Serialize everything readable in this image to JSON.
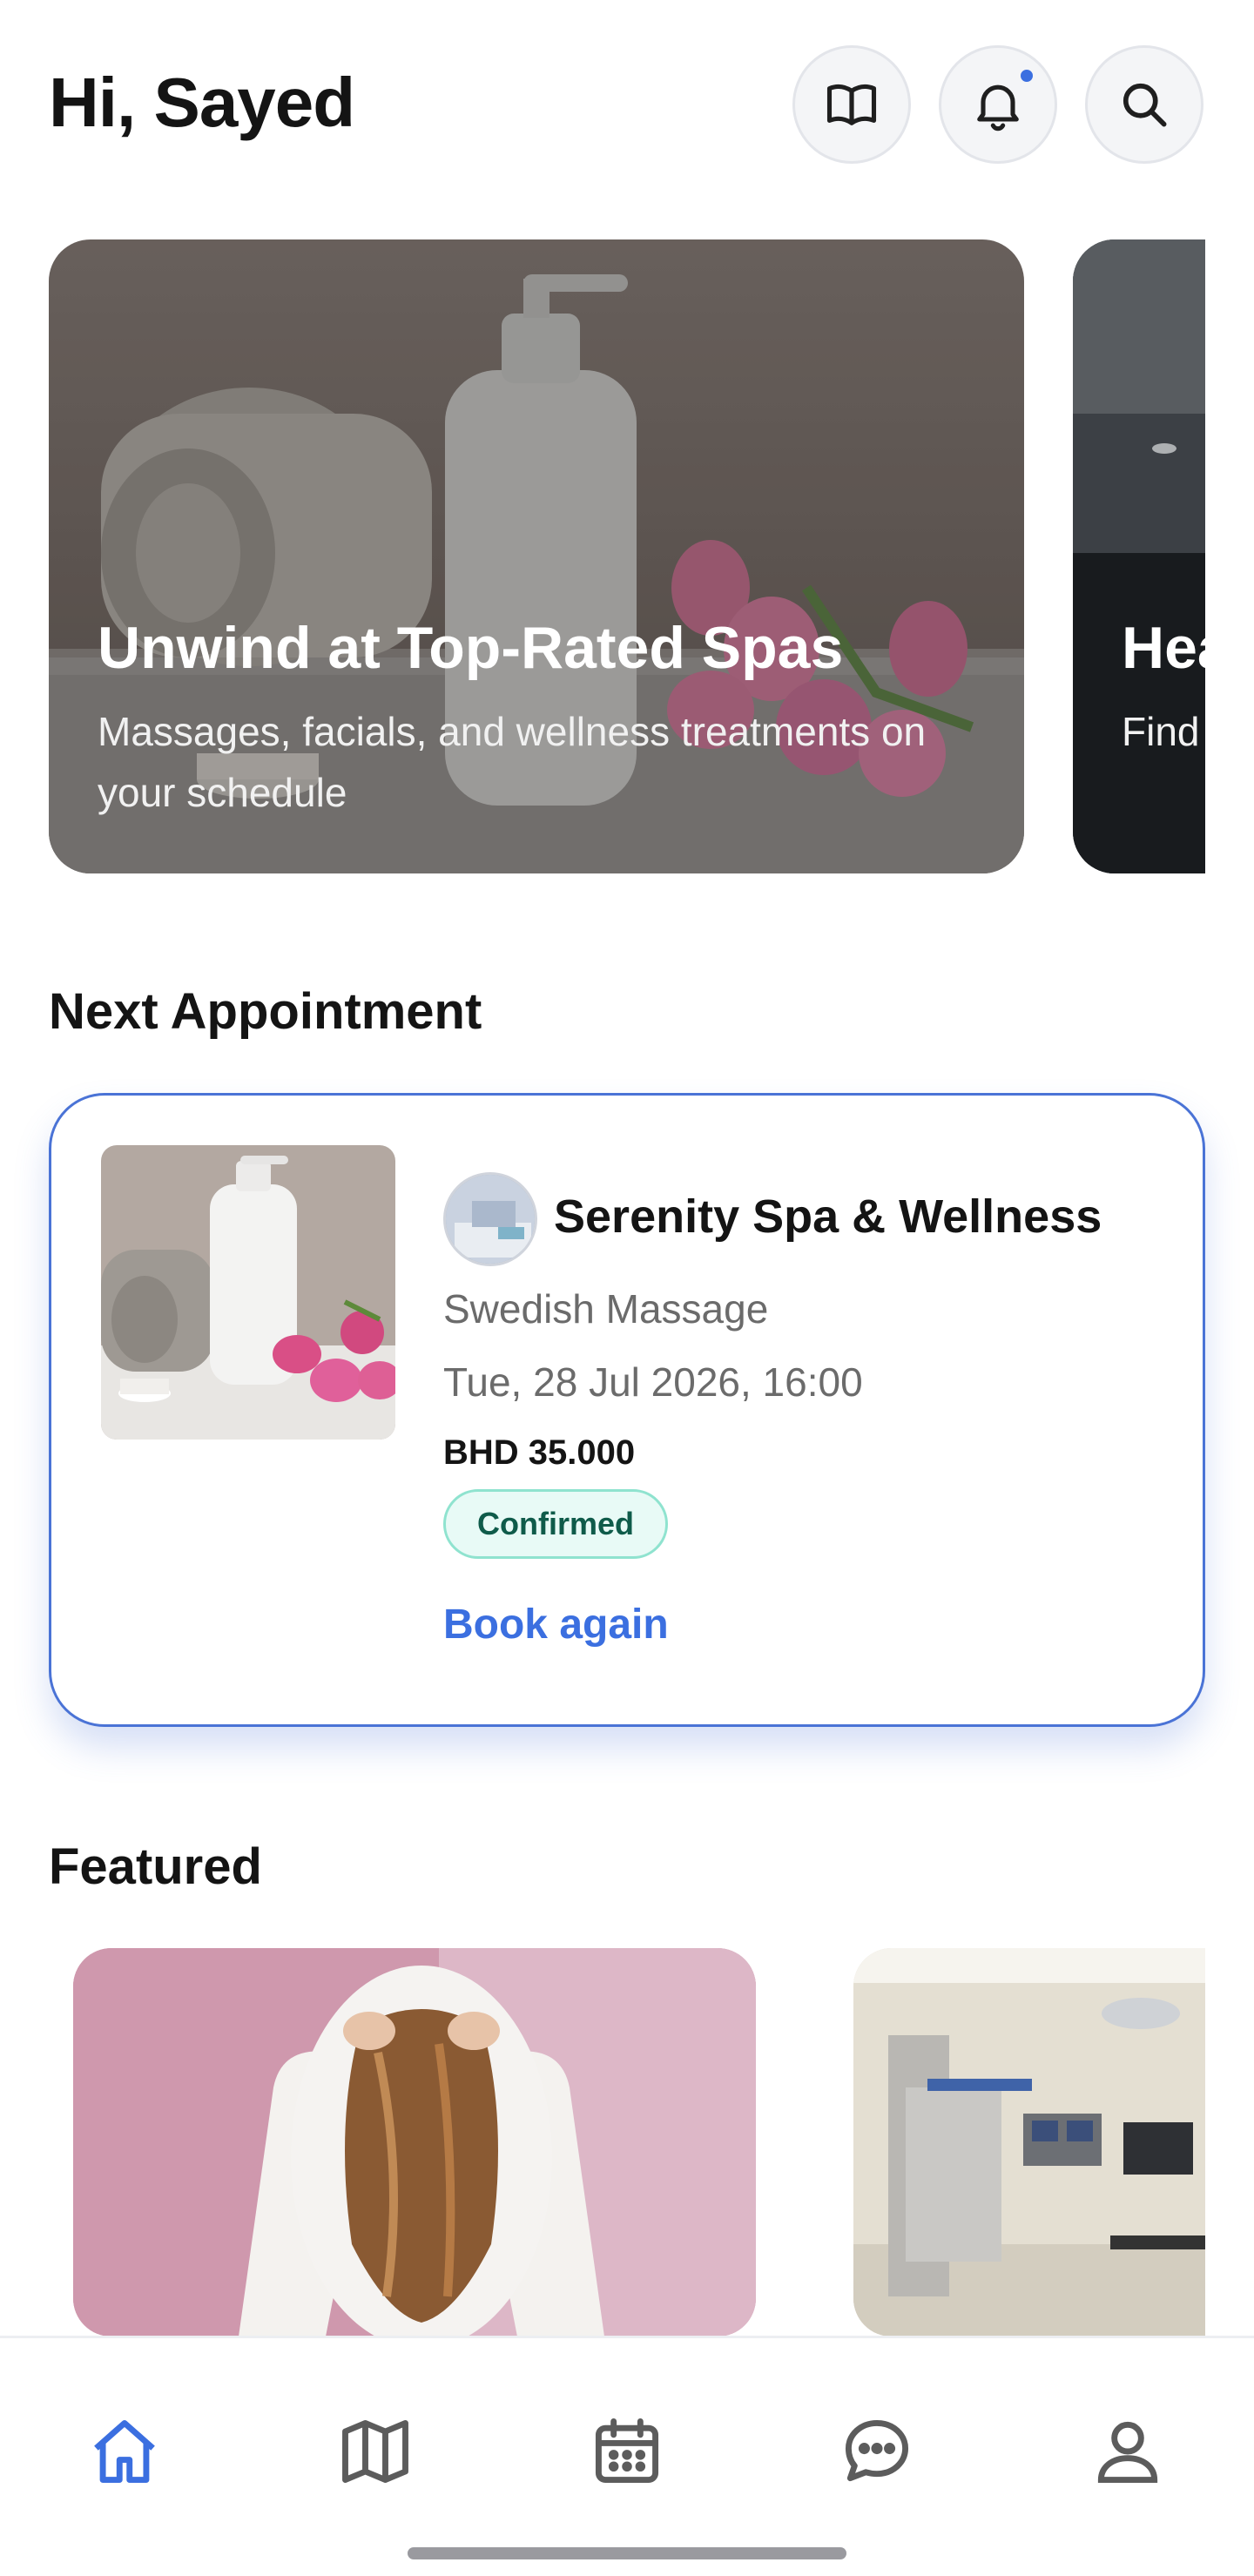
{
  "header": {
    "greeting": "Hi, Sayed",
    "icons": [
      "book-icon",
      "bell-icon",
      "search-icon"
    ],
    "has_notification": true
  },
  "hero_cards": [
    {
      "title": "Unwind at Top-Rated Spas",
      "subtitle": "Massages, facials, and wellness treatments on your schedule"
    },
    {
      "title": "Hea",
      "subtitle": "Find revie"
    }
  ],
  "next_appointment": {
    "section_title": "Next Appointment",
    "venue_name": "Serenity Spa & Wellness",
    "service": "Swedish Massage",
    "datetime": "Tue, 28 Jul 2026, 16:00",
    "price": "BHD 35.000",
    "status": "Confirmed",
    "action": "Book again"
  },
  "featured": {
    "section_title": "Featured"
  },
  "bottom_nav": {
    "items": [
      "home-icon",
      "map-icon",
      "calendar-icon",
      "chat-icon",
      "profile-icon"
    ],
    "active": "home-icon"
  },
  "colors": {
    "accent": "#3b6fe0",
    "status_bg": "#e8faf6",
    "status_text": "#0f5b4a"
  }
}
